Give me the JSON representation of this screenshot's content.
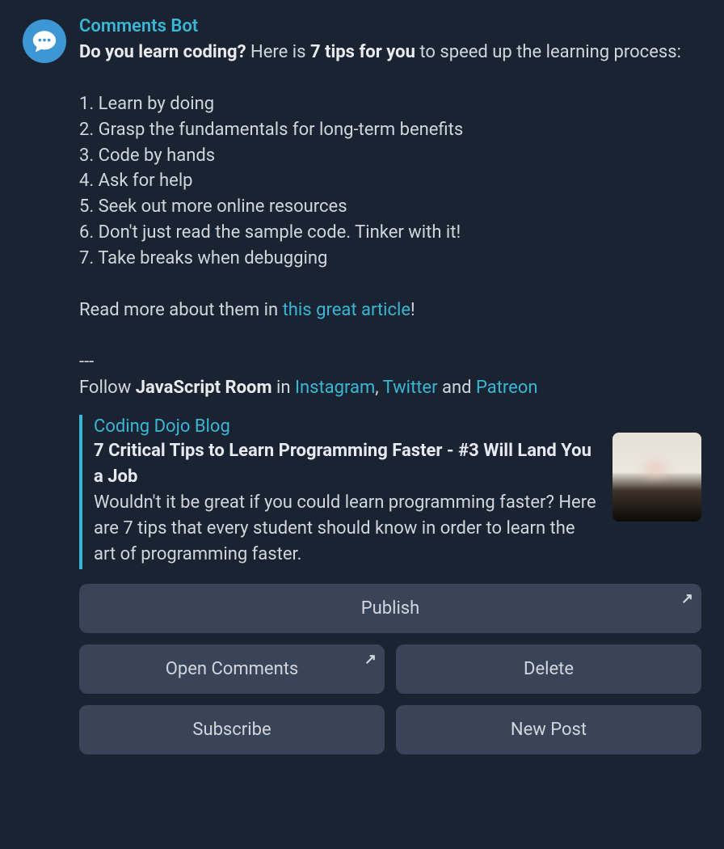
{
  "author": "Comments Bot",
  "post": {
    "lead_q": "Do you learn coding?",
    "lead_mid": " Here is ",
    "lead_bold": "7 tips for you",
    "lead_end": " to speed up the learning process:",
    "tips": [
      "1. Learn by doing",
      "2. Grasp the fundamentals for long-term benefits",
      "3. Code by hands",
      "4. Ask for help",
      "5. Seek out more online resources",
      "6. Don't just read the sample code. Tinker with it!",
      "7. Take breaks when debugging"
    ],
    "read_more_prefix": "Read more about them in ",
    "read_more_link": "this great article",
    "read_more_suffix": "!",
    "divider": "---",
    "follow_prefix": "Follow ",
    "follow_room": "JavaScript Room",
    "follow_in": " in ",
    "follow_links": {
      "instagram": "Instagram",
      "sep1": ", ",
      "twitter": "Twitter",
      "sep2": " and ",
      "patreon": "Patreon"
    }
  },
  "preview": {
    "source": "Coding Dojo Blog",
    "title": "7 Critical Tips to Learn Programming Faster - #3 Will Land You a Job",
    "desc": "Wouldn't it be great if you could learn programming faster? Here are 7 tips that every student should know in order to learn the art of programming faster."
  },
  "buttons": {
    "publish": "Publish",
    "open_comments": "Open Comments",
    "delete": "Delete",
    "subscribe": "Subscribe",
    "new_post": "New Post"
  },
  "icons": {
    "arrow": "↗"
  }
}
